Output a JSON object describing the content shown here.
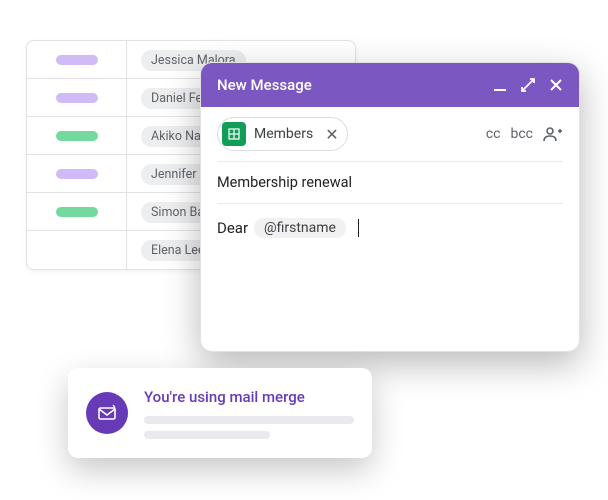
{
  "sheet": {
    "rows": [
      {
        "color": "purple",
        "name": "Jessica Malora"
      },
      {
        "color": "purple",
        "name": "Daniel Fern"
      },
      {
        "color": "green",
        "name": "Akiko Naka"
      },
      {
        "color": "purple",
        "name": "Jennifer Ac"
      },
      {
        "color": "green",
        "name": "Simon Balli"
      },
      {
        "color": "",
        "name": "Elena Lee"
      }
    ]
  },
  "compose": {
    "title": "New Message",
    "recipient_label": "Members",
    "cc": "cc",
    "bcc": "bcc",
    "subject": "Membership renewal",
    "body_prefix": "Dear",
    "merge_tag": "@firstname"
  },
  "toast": {
    "title": "You're using mail merge"
  }
}
